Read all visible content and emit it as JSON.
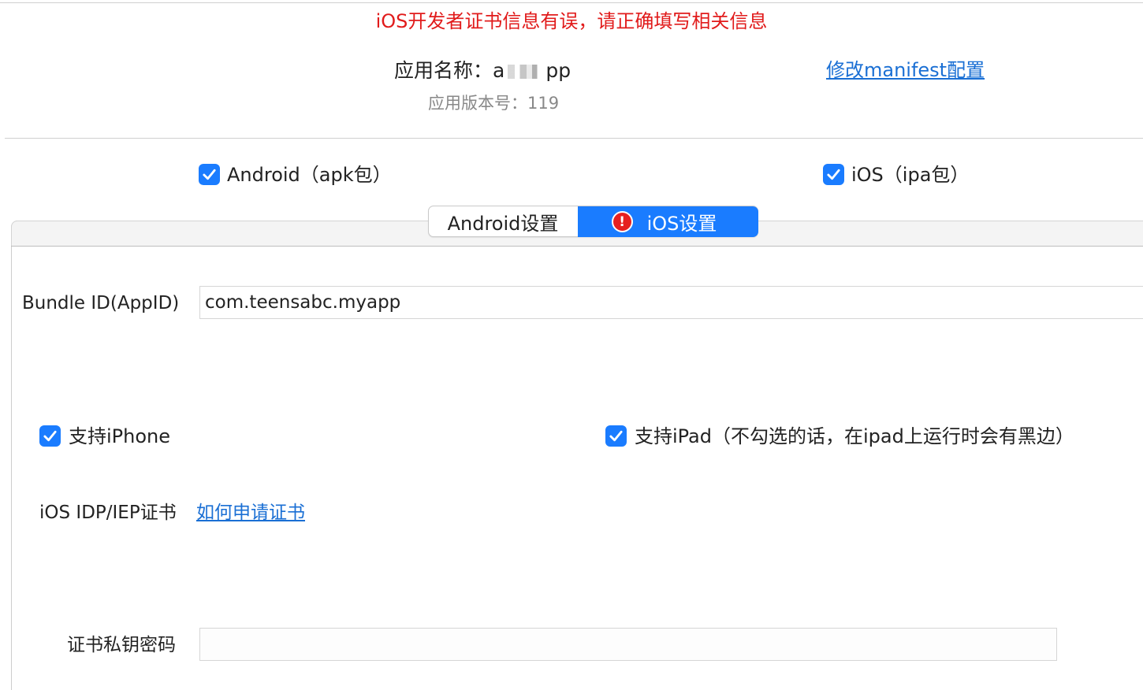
{
  "colors": {
    "error": "#e11b1b",
    "link": "#1a6fd4",
    "accent": "#1a7cff",
    "checkbox": "#1a7cff"
  },
  "header": {
    "error_message": "iOS开发者证书信息有误，请正确填写相关信息",
    "app_name_label": "应用名称：",
    "app_name_visible_prefix": "a",
    "app_name_visible_suffix": "pp",
    "app_version": "应用版本号：119",
    "manifest_link": "修改manifest配置"
  },
  "platforms": {
    "android": {
      "label": "Android（apk包）",
      "checked": true,
      "icon": "checkmark-icon"
    },
    "ios": {
      "label": "iOS（ipa包）",
      "checked": true,
      "icon": "checkmark-icon"
    }
  },
  "tabs": {
    "android": {
      "label": "Android设置",
      "selected": false
    },
    "ios": {
      "label": "iOS设置",
      "selected": true,
      "icon": "error-alert-icon",
      "icon_glyph": "!"
    }
  },
  "ios_settings": {
    "bundle_id_label": "Bundle ID(AppID)",
    "bundle_id_value": "com.teensabc.myapp",
    "support_iphone": {
      "label": "支持iPhone",
      "checked": true
    },
    "support_ipad": {
      "label": "支持iPad（不勾选的话，在ipad上运行时会有黑边）",
      "checked": true
    },
    "cert_label": "iOS IDP/IEP证书",
    "cert_help_link": "如何申请证书",
    "private_key_label": "证书私钥密码",
    "private_key_value": ""
  }
}
